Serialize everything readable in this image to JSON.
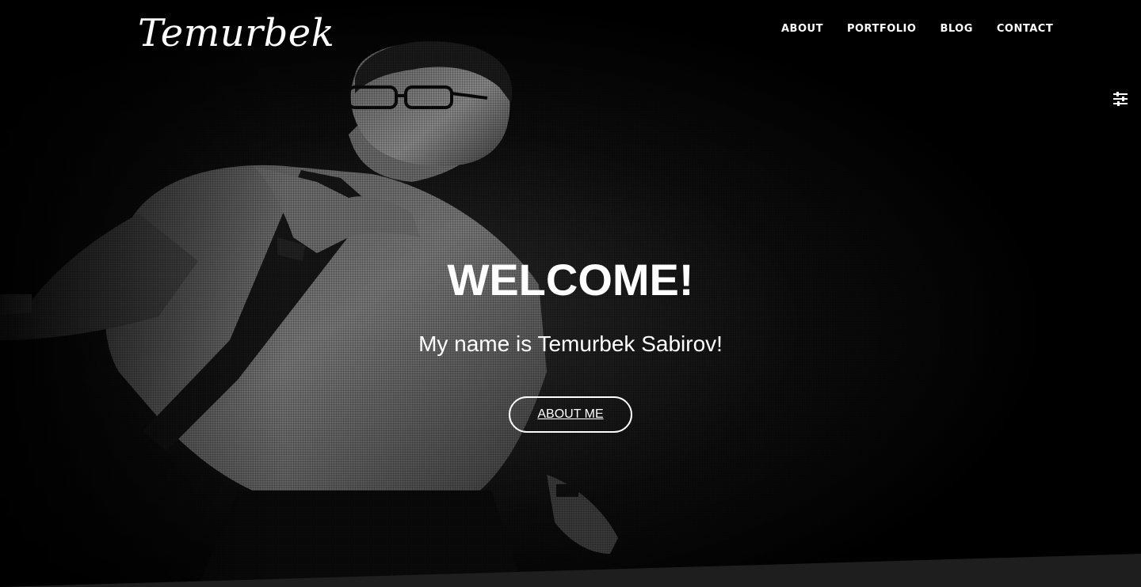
{
  "header": {
    "logo_text": "Temurbek",
    "nav": [
      {
        "label": "ABOUT"
      },
      {
        "label": "PORTFOLIO"
      },
      {
        "label": "BLOG"
      },
      {
        "label": "CONTACT"
      }
    ]
  },
  "controls": {
    "settings_icon": "sliders-icon"
  },
  "hero": {
    "title": "WELCOME!",
    "subtitle": "My name is Temurbek Sabirov!",
    "button_label": "ABOUT ME",
    "background_image": "portrait-of-young-man-with-glasses-and-backpack"
  },
  "colors": {
    "background": "#000000",
    "text": "#ffffff",
    "bottom_section": "#1e1e1e"
  }
}
